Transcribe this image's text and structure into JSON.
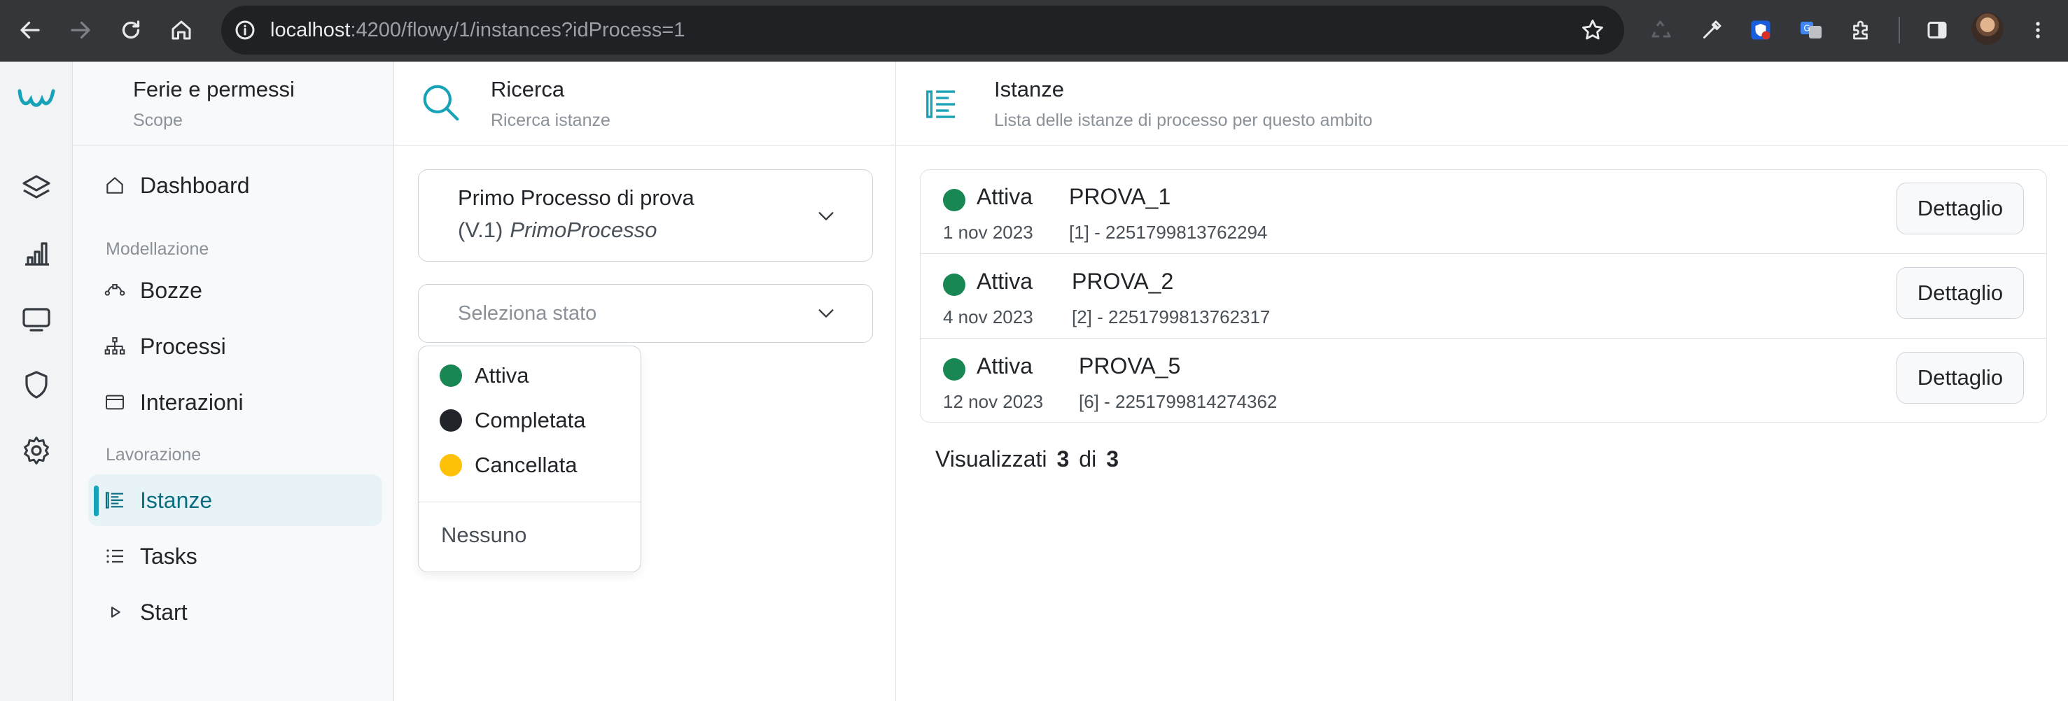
{
  "browser": {
    "url_host": "localhost",
    "url_path": ":4200/flowy/1/instances?idProcess=1"
  },
  "scope": {
    "title": "Ferie e permessi",
    "subtitle": "Scope"
  },
  "nav": {
    "dashboard": "Dashboard",
    "section_modeling": "Modellazione",
    "drafts": "Bozze",
    "processes": "Processi",
    "interactions": "Interazioni",
    "section_work": "Lavorazione",
    "instances": "Istanze",
    "tasks": "Tasks",
    "start": "Start"
  },
  "search": {
    "title": "Ricerca",
    "subtitle": "Ricerca istanze",
    "process_name": "Primo Processo di prova",
    "process_version": "(V.1)",
    "process_key": "PrimoProcesso",
    "state_placeholder": "Seleziona stato",
    "state_options": [
      {
        "label": "Attiva",
        "color": "#198754"
      },
      {
        "label": "Completata",
        "color": "#212529"
      },
      {
        "label": "Cancellata",
        "color": "#ffc107"
      }
    ],
    "state_none": "Nessuno"
  },
  "instances": {
    "title": "Istanze",
    "subtitle": "Lista delle istanze di processo per questo ambito",
    "detail_label": "Dettaglio",
    "rows": [
      {
        "status": "Attiva",
        "status_color": "#198754",
        "date": "1 nov 2023",
        "name": "PROVA_1",
        "id": "[1] - 2251799813762294"
      },
      {
        "status": "Attiva",
        "status_color": "#198754",
        "date": "4 nov 2023",
        "name": "PROVA_2",
        "id": "[2] - 2251799813762317"
      },
      {
        "status": "Attiva",
        "status_color": "#198754",
        "date": "12 nov 2023",
        "name": "PROVA_5",
        "id": "[6] - 2251799814274362"
      }
    ],
    "shown_prefix": "Visualizzati",
    "shown_count": "3",
    "shown_of": "di",
    "shown_total": "3"
  },
  "colors": {
    "accent": "#17a2b8",
    "active_status": "#198754",
    "warning": "#ffc107"
  }
}
